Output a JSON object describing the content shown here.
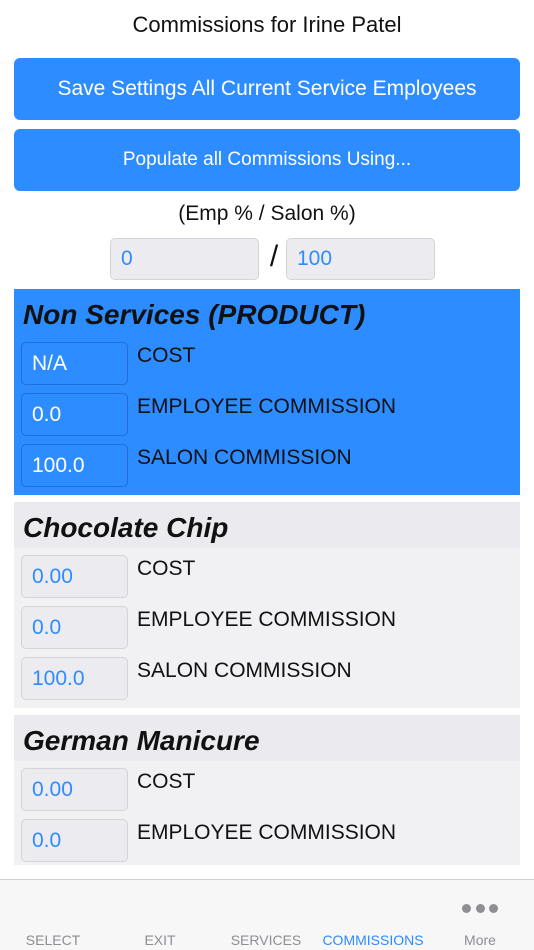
{
  "header": {
    "title": "Commissions for Irine Patel"
  },
  "actions": {
    "save_label": "Save Settings All Current Service Employees",
    "populate_label": "Populate all Commissions Using..."
  },
  "ratio": {
    "label": "(Emp % / Salon %)",
    "emp_value": "0",
    "separator": "/",
    "salon_value": "100"
  },
  "sections": [
    {
      "title": "Non Services (PRODUCT)",
      "cost": "N/A",
      "cost_label": "COST",
      "employee_commission": "0.0",
      "employee_label": "EMPLOYEE COMMISSION",
      "salon_commission": "100.0",
      "salon_label": "SALON COMMISSION"
    },
    {
      "title": "Chocolate Chip",
      "cost": "0.00",
      "cost_label": "COST",
      "employee_commission": "0.0",
      "employee_label": "EMPLOYEE COMMISSION",
      "salon_commission": "100.0",
      "salon_label": "SALON COMMISSION"
    },
    {
      "title": "German Manicure",
      "cost": "0.00",
      "cost_label": "COST",
      "employee_commission": "0.0",
      "employee_label": "EMPLOYEE COMMISSION"
    }
  ],
  "tabbar": {
    "tabs": [
      {
        "label": "SELECT"
      },
      {
        "label": "EXIT"
      },
      {
        "label": "SERVICES"
      },
      {
        "label": "COMMISSIONS",
        "active": true
      },
      {
        "label": "More",
        "icon": "more-dots-icon"
      }
    ]
  },
  "colors": {
    "accent": "#2d8cff",
    "card_grey": "#f1f1f4",
    "tab_inactive": "#8e8e93"
  }
}
